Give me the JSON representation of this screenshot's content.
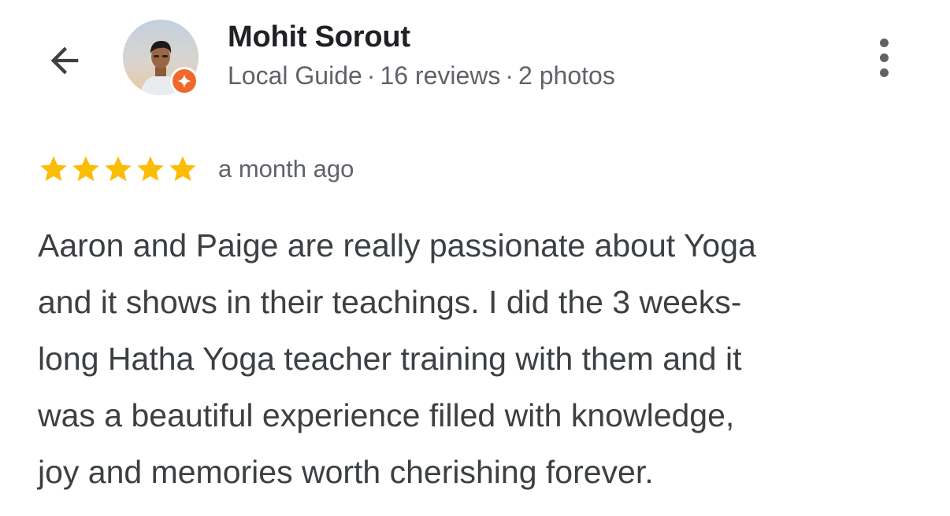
{
  "header": {
    "back_icon": "arrow-back-icon",
    "reviewer": {
      "name": "Mohit Sorout",
      "badge_icon": "local-guide-badge-icon",
      "meta": {
        "level": "Local Guide",
        "reviews": "16 reviews",
        "photos": "2 photos",
        "separator": "·"
      }
    },
    "more_icon": "more-vertical-icon"
  },
  "review": {
    "rating": 5,
    "rating_max": 5,
    "date": "a month ago",
    "text": "Aaron and Paige are really passionate about Yoga\nand it shows in their teachings. I did the 3 weeks-\nlong Hatha Yoga teacher training with them and it\nwas a beautiful experience filled with knowledge,\njoy and memories worth cherishing forever."
  },
  "colors": {
    "star": "#fbbc04",
    "badge": "#f1682b",
    "name": "#202124",
    "secondary_text": "#5f6368",
    "body_text": "#3c4043"
  }
}
